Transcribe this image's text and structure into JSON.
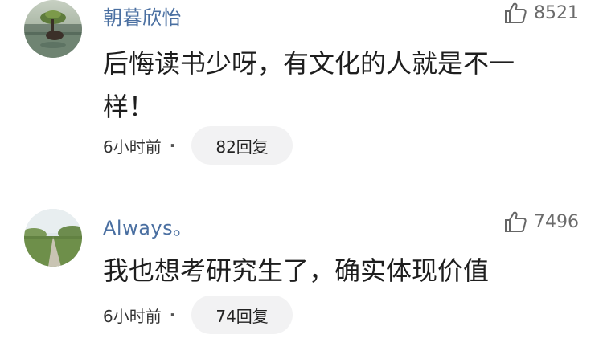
{
  "comments": [
    {
      "username": "朝暮欣怡",
      "likes": "8521",
      "text": "后悔读书少呀，有文化的人就是不一样！",
      "time": "6小时前",
      "replies": "82回复",
      "avatar": "tree-lake-avatar"
    },
    {
      "username": "Always。",
      "likes": "7496",
      "text": "我也想考研究生了，确实体现价值",
      "time": "6小时前",
      "replies": "74回复",
      "avatar": "country-road-avatar"
    }
  ],
  "colors": {
    "username": "#4a6fa1",
    "meta": "#6b6b6b",
    "reply_bg": "#f2f2f3"
  }
}
